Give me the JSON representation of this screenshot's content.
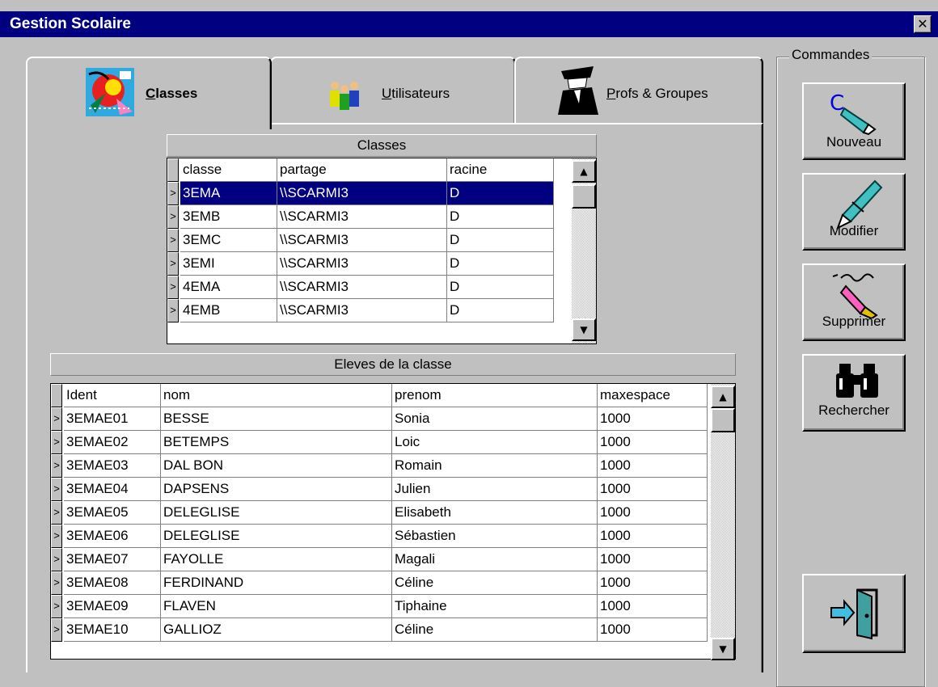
{
  "window": {
    "title": "Gestion Scolaire",
    "close_glyph": "✕"
  },
  "tabs": [
    {
      "label": "Classes",
      "icon": "classes-drawing-icon",
      "active": true
    },
    {
      "label": "Utilisateurs",
      "icon": "users-icon",
      "active": false
    },
    {
      "label": "Profs & Groupes",
      "icon": "profs-icon",
      "active": false
    }
  ],
  "classes_grid": {
    "caption": "Classes",
    "columns": [
      "classe",
      "partage",
      "racine"
    ],
    "rows": [
      [
        "3EMA",
        "\\\\SCARMI3",
        "D"
      ],
      [
        "3EMB",
        "\\\\SCARMI3",
        "D"
      ],
      [
        "3EMC",
        "\\\\SCARMI3",
        "D"
      ],
      [
        "3EMI",
        "\\\\SCARMI3",
        "D"
      ],
      [
        "4EMA",
        "\\\\SCARMI3",
        "D"
      ],
      [
        "4EMB",
        "\\\\SCARMI3",
        "D"
      ]
    ],
    "selected_row": 0
  },
  "eleves_grid": {
    "caption": "Eleves de la classe",
    "columns": [
      "Ident",
      "nom",
      "prenom",
      "maxespace"
    ],
    "rows": [
      [
        "3EMAE01",
        "BESSE",
        "Sonia",
        "1000"
      ],
      [
        "3EMAE02",
        "BETEMPS",
        "Loic",
        "1000"
      ],
      [
        "3EMAE03",
        "DAL BON",
        "Romain",
        "1000"
      ],
      [
        "3EMAE04",
        "DAPSENS",
        "Julien",
        "1000"
      ],
      [
        "3EMAE05",
        "DELEGLISE",
        "Elisabeth",
        "1000"
      ],
      [
        "3EMAE06",
        "DELEGLISE",
        "Sébastien",
        "1000"
      ],
      [
        "3EMAE07",
        "FAYOLLE",
        "Magali",
        "1000"
      ],
      [
        "3EMAE08",
        "FERDINAND",
        "Céline",
        "1000"
      ],
      [
        "3EMAE09",
        "FLAVEN",
        "Tiphaine",
        "1000"
      ],
      [
        "3EMAE10",
        "GALLIOZ",
        "Céline",
        "1000"
      ]
    ]
  },
  "row_indicator": ">",
  "scroll_up": "▲",
  "scroll_down": "▼",
  "commandes": {
    "label": "Commandes",
    "buttons": [
      {
        "label": "Nouveau",
        "icon": "pen-new-icon"
      },
      {
        "label": "Modifier",
        "icon": "pen-edit-icon"
      },
      {
        "label": "Supprimer",
        "icon": "eraser-icon"
      },
      {
        "label": "Rechercher",
        "icon": "binoculars-icon"
      }
    ],
    "exit_icon": "exit-door-icon"
  }
}
